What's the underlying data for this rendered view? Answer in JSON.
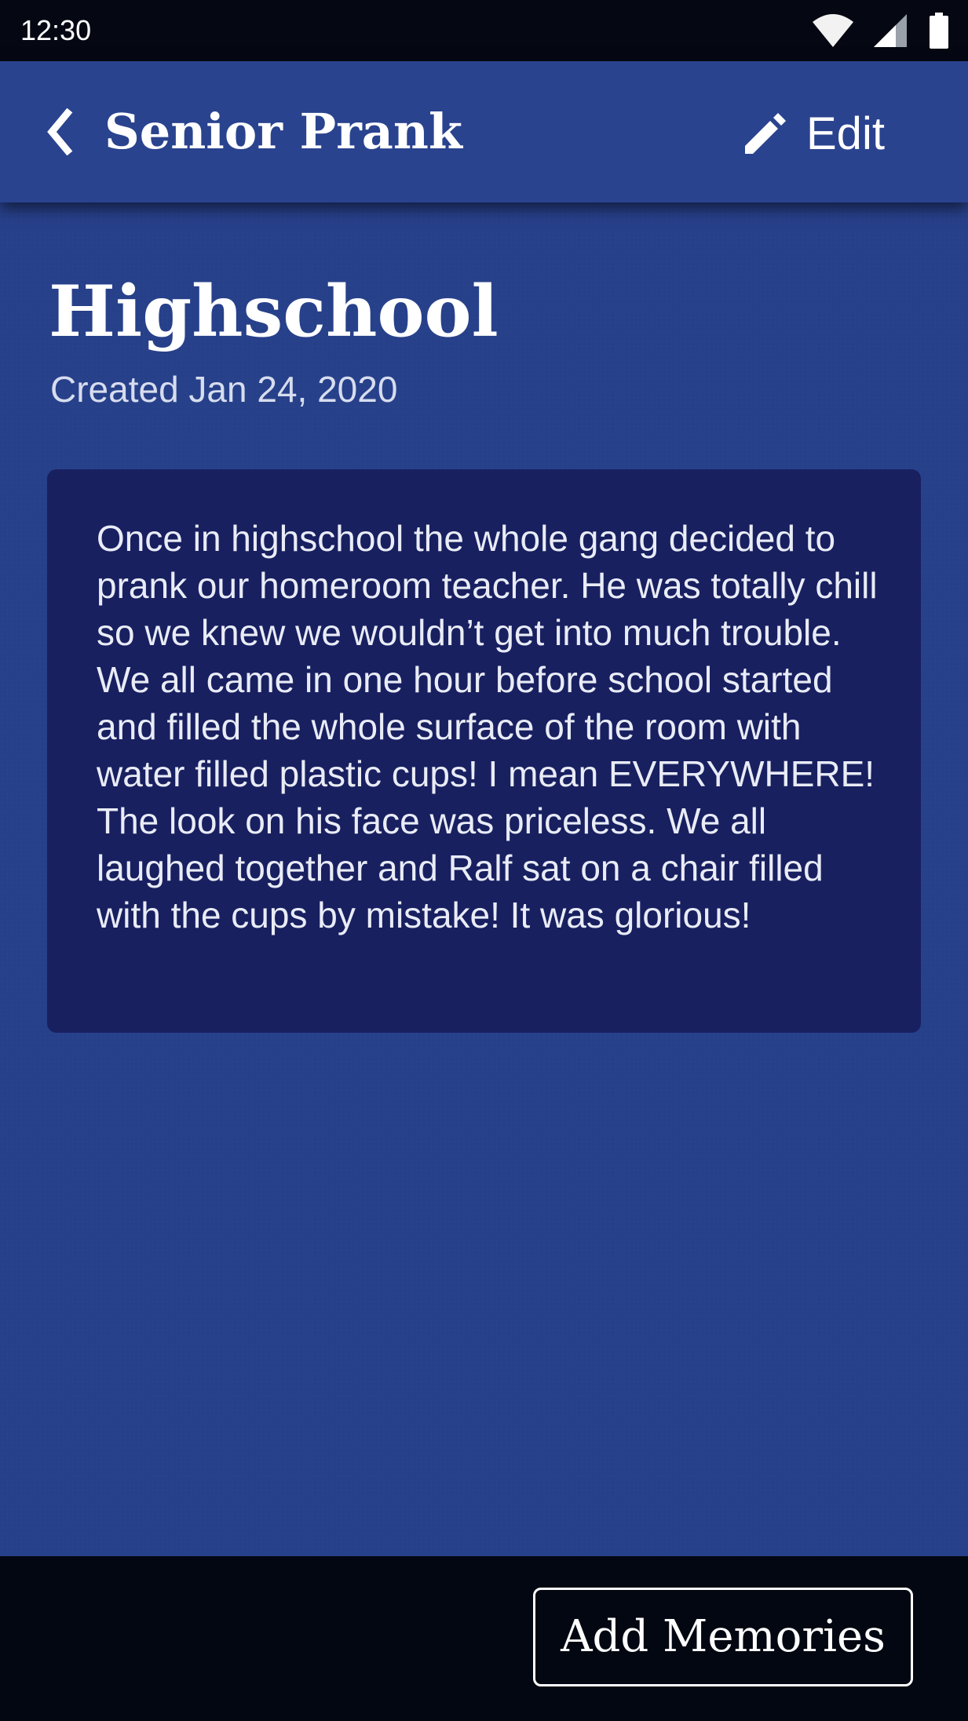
{
  "status_bar": {
    "time": "12:30",
    "icons": [
      "wifi-icon",
      "signal-icon",
      "battery-icon"
    ]
  },
  "app_bar": {
    "back_icon": "chevron-left-icon",
    "title": "Senior Prank",
    "edit_icon": "pencil-icon",
    "edit_label": "Edit"
  },
  "main": {
    "heading": "Highschool",
    "created": "Created Jan 24, 2020",
    "story": "Once in highschool the whole gang decided to prank our homeroom teacher. He was totally chill so we knew we wouldn’t get into much trouble. We all came in one hour before school started and filled the whole surface of the room with water filled plastic cups! I mean EVERYWHERE! The look on his face was priceless. We all laughed together and Ralf sat on a chair filled with the cups by mistake! It was glorious!"
  },
  "bottom_bar": {
    "add_label": "Add Memories"
  },
  "colors": {
    "app_bar": "#2a438f",
    "background": "#27408a",
    "card": "#182060",
    "status_bar": "#050813"
  }
}
